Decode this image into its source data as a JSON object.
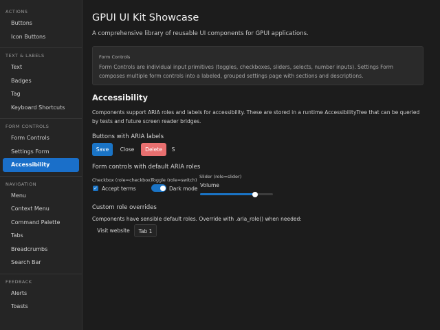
{
  "sidebar": {
    "sections": [
      {
        "title": "ACTIONS",
        "items": [
          "Buttons",
          "Icon Buttons"
        ]
      },
      {
        "title": "TEXT & LABELS",
        "items": [
          "Text",
          "Badges",
          "Tag",
          "Keyboard Shortcuts"
        ]
      },
      {
        "title": "FORM CONTROLS",
        "items": [
          "Form Controls",
          "Settings Form",
          "Accessibility"
        ]
      },
      {
        "title": "NAVIGATION",
        "items": [
          "Menu",
          "Context Menu",
          "Command Palette",
          "Tabs",
          "Breadcrumbs",
          "Search Bar"
        ]
      },
      {
        "title": "FEEDBACK",
        "items": [
          "Alerts",
          "Toasts"
        ]
      }
    ],
    "active_item": "Accessibility"
  },
  "page": {
    "title": "GPUI UI Kit Showcase",
    "subtitle": "A comprehensive library of reusable UI components for GPUI applications."
  },
  "note": {
    "title": "Form Controls",
    "body": "Form Controls are individual input primitives (toggles, checkboxes, sliders, selects, number inputs). Settings Form composes multiple form controls into a labeled, grouped settings page with sections and descriptions."
  },
  "accessibility": {
    "heading": "Accessibility",
    "description": "Components support ARIA roles and labels for accessibility. These are stored in a runtime AccessibilityTree that can be queried by tests and future screen reader bridges.",
    "buttons_heading": "Buttons with ARIA labels",
    "buttons": {
      "save": "Save",
      "close": "Close",
      "delete": "Delete",
      "s": "S"
    },
    "controls_heading": "Form controls with default ARIA roles",
    "checkbox": {
      "caption": "Checkbox (role=checkbox)",
      "label": "Accept terms",
      "checked": true
    },
    "toggle": {
      "caption": "Toggle (role=switch)",
      "label": "Dark mode",
      "on": true
    },
    "slider": {
      "caption": "Slider (role=slider)",
      "label": "Volume",
      "value": 0.75
    },
    "custom_heading": "Custom role overrides",
    "custom_description": "Components have sensible default roles. Override with .aria_role() when needed:",
    "link_label": "Visit website",
    "tab_label": "Tab 1"
  },
  "colors": {
    "accent": "#1a74c6",
    "danger": "#e86f6f",
    "background": "#1c1c1c",
    "sidebar": "#252525"
  }
}
